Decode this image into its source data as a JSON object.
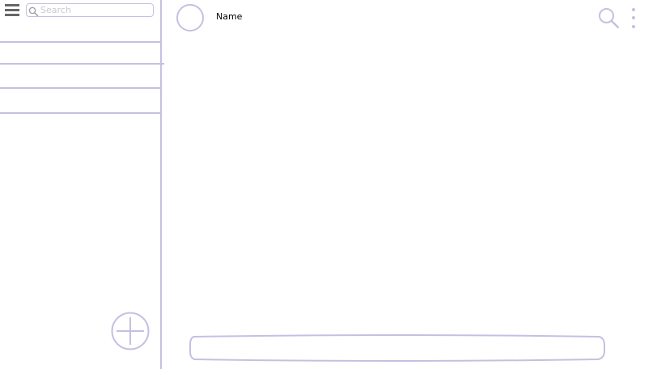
{
  "sidebar": {
    "search": {
      "placeholder": "Search",
      "value": ""
    },
    "items": [
      {
        "label": ""
      },
      {
        "label": ""
      },
      {
        "label": ""
      }
    ]
  },
  "chat": {
    "contact_name": "Name",
    "composer": {
      "placeholder": "",
      "value": ""
    }
  },
  "icons": {
    "menu": "hamburger-menu-icon",
    "search": "magnifier-icon",
    "more": "vertical-dots-icon",
    "add": "circle-plus-icon"
  },
  "colors": {
    "accent": "#c5c0e2",
    "placeholder": "#c8c8d2",
    "menu_icon": "#666666",
    "background": "#ffffff"
  }
}
